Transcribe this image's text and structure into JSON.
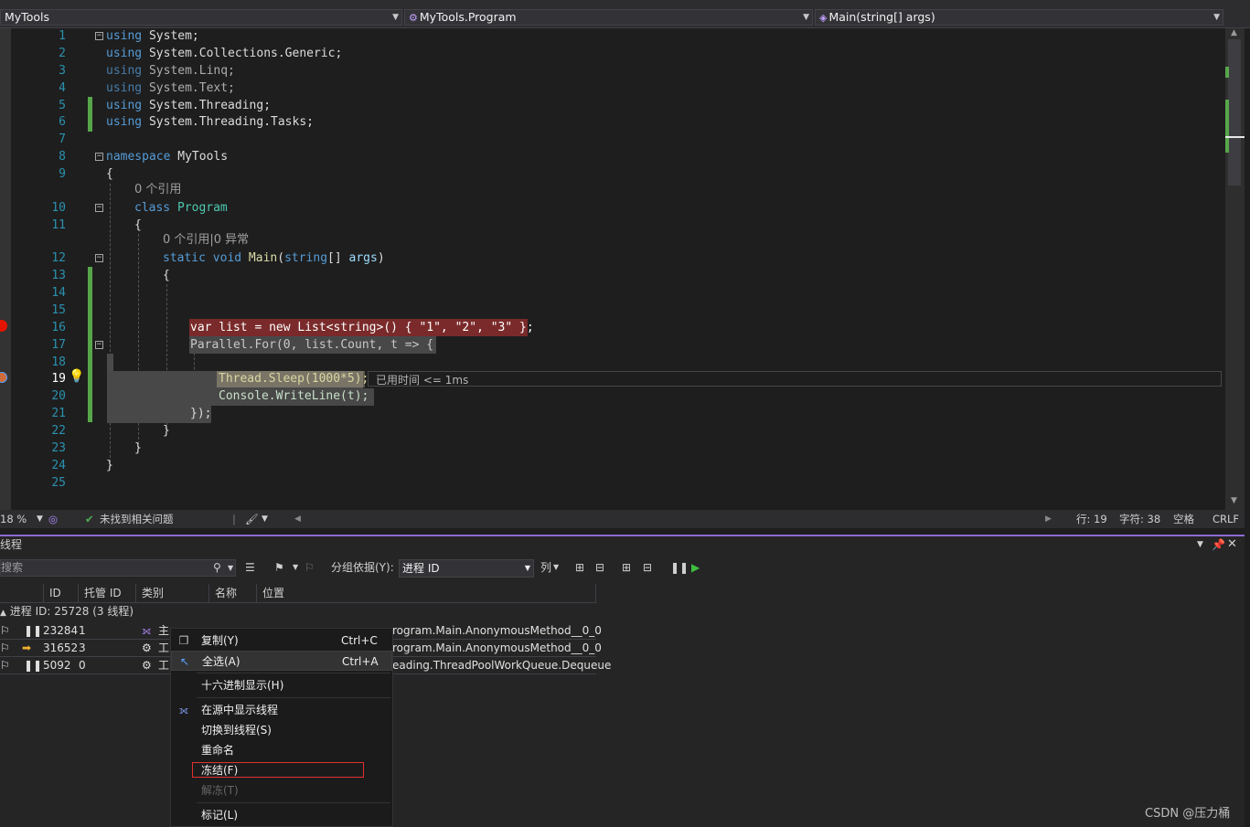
{
  "navbar": {
    "project": "MyTools",
    "type": "MyTools.Program",
    "member": "Main(string[] args)"
  },
  "editor": {
    "line_numbers": [
      "1",
      "2",
      "3",
      "4",
      "5",
      "6",
      "7",
      "8",
      "9",
      "10",
      "11",
      "12",
      "13",
      "14",
      "15",
      "16",
      "17",
      "18",
      "19",
      "20",
      "21",
      "22",
      "23",
      "24",
      "25"
    ],
    "lines": {
      "l1": {
        "kw": "using",
        "rest": " System;"
      },
      "l2": {
        "kw": "using",
        "rest": " System.Collections.Generic;"
      },
      "l3": {
        "kw": "using",
        "rest": " System.Linq;"
      },
      "l4": {
        "kw": "using",
        "rest": " System.Text;"
      },
      "l5": {
        "kw": "using",
        "rest": " System.Threading;"
      },
      "l6": {
        "kw": "using",
        "rest": " System.Threading.Tasks;"
      },
      "l8": {
        "kw": "namespace",
        "rest": " MyTools"
      },
      "l9": "{",
      "codelens1": "0 个引用",
      "l10": {
        "kw": "class",
        "name": " Program"
      },
      "l11": "{",
      "codelens2": "0 个引用|0 异常",
      "l12": {
        "kw1": "static",
        "kw2": " void",
        "name": " Main",
        "open": "(",
        "kw3": "string",
        "rest": "[] ",
        "prm": "args",
        "close": ")"
      },
      "l13": "{",
      "l16": "var list = new List<string>() { \"1\", \"2\", \"3\" };",
      "l17": "Parallel.For(0, list.Count, t => {",
      "l19": "Thread.Sleep(1000*5);",
      "l19_hint": "已用时间 <= 1ms",
      "l20": "Console.WriteLine(t);",
      "l21": "});",
      "l22": "}",
      "l23": "}",
      "l24": "}"
    }
  },
  "statusbar": {
    "zoom": "18 %",
    "issues": "未找到相关问题",
    "line": "行: 19",
    "char": "字符: 38",
    "space": "空格",
    "eol": "CRLF"
  },
  "threads_panel": {
    "title": "线程",
    "search_placeholder": "搜索",
    "group_by_label": "分组依据(Y):",
    "group_by_value": "进程 ID",
    "columns_label": "列",
    "headers": [
      "ID",
      "托管 ID",
      "类别",
      "名称",
      "位置"
    ],
    "process_row": "进程 ID: 25728  (3 线程)",
    "rows": [
      {
        "id": "23284",
        "managed": "1",
        "category": "主",
        "location": "rogram.Main.AnonymousMethod__0_0"
      },
      {
        "id": "31652",
        "managed": "3",
        "category": "工",
        "location": "rogram.Main.AnonymousMethod__0_0"
      },
      {
        "id": "5092",
        "managed": "0",
        "category": "工",
        "location": "eading.ThreadPoolWorkQueue.Dequeue"
      }
    ]
  },
  "context_menu": {
    "items": [
      {
        "label": "复制(Y)",
        "shortcut": "Ctrl+C"
      },
      {
        "label": "全选(A)",
        "shortcut": "Ctrl+A"
      },
      {
        "label": "十六进制显示(H)",
        "shortcut": ""
      },
      {
        "label": "在源中显示线程",
        "shortcut": ""
      },
      {
        "label": "切换到线程(S)",
        "shortcut": ""
      },
      {
        "label": "重命名",
        "shortcut": ""
      },
      {
        "label": "冻结(F)",
        "shortcut": ""
      },
      {
        "label": "解冻(T)",
        "shortcut": ""
      },
      {
        "label": "标记(L)",
        "shortcut": ""
      }
    ]
  },
  "watermark": "CSDN @压力桶",
  "colors": {
    "breakpoint_bg": "#7a2a2a",
    "accent_purple": "#8e6bd4",
    "change_green": "#57a64a",
    "freeze_outline": "#e03030"
  }
}
